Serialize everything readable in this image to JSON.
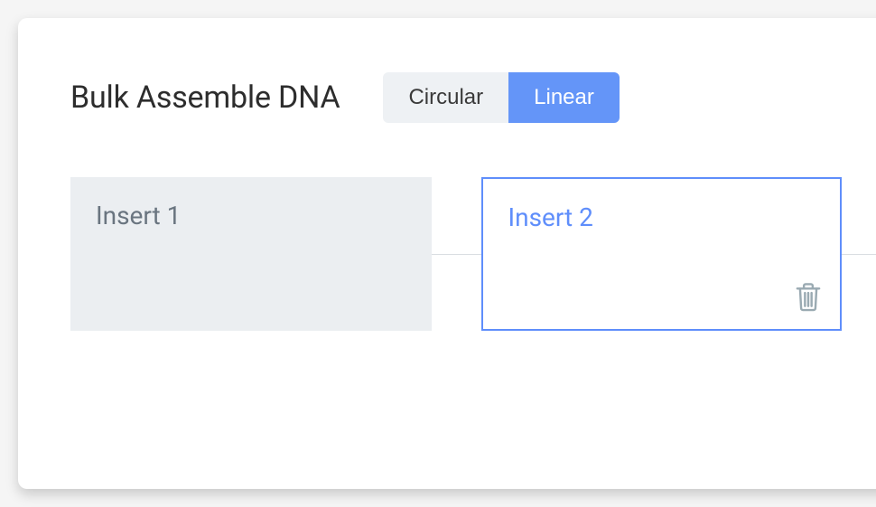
{
  "header": {
    "title": "Bulk Assemble DNA"
  },
  "topology_toggle": {
    "options": [
      "Circular",
      "Linear"
    ],
    "selected": "Linear"
  },
  "inserts": [
    {
      "label": "Insert 1",
      "selected": false,
      "deletable": false
    },
    {
      "label": "Insert 2",
      "selected": true,
      "deletable": true
    }
  ]
}
